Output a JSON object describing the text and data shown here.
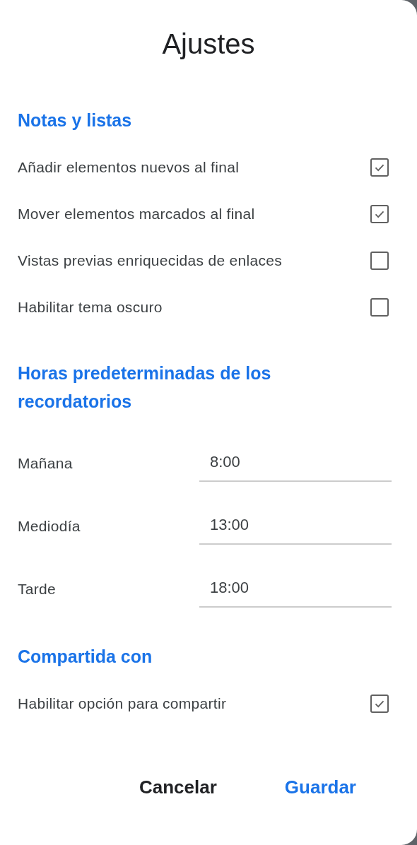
{
  "dialog": {
    "title": "Ajustes"
  },
  "sections": [
    {
      "heading": "Notas y listas",
      "items": [
        {
          "kind": "checkbox",
          "label": "Añadir elementos nuevos al final",
          "checked": true
        },
        {
          "kind": "checkbox",
          "label": "Mover elementos marcados al final",
          "checked": true
        },
        {
          "kind": "checkbox",
          "label": "Vistas previas enriquecidas de enlaces",
          "checked": false
        },
        {
          "kind": "checkbox",
          "label": "Habilitar tema oscuro",
          "checked": false
        }
      ]
    },
    {
      "heading": "Horas predeterminadas de los recordatorios",
      "items": [
        {
          "kind": "time",
          "label": "Mañana",
          "value": "8:00"
        },
        {
          "kind": "time",
          "label": "Mediodía",
          "value": "13:00"
        },
        {
          "kind": "time",
          "label": "Tarde",
          "value": "18:00"
        }
      ]
    },
    {
      "heading": "Compartida con",
      "items": [
        {
          "kind": "checkbox",
          "label": "Habilitar opción para compartir",
          "checked": true
        }
      ]
    }
  ],
  "buttons": [
    {
      "label": "Cancelar",
      "kind": "secondary"
    },
    {
      "label": "Guardar",
      "kind": "primary"
    }
  ]
}
